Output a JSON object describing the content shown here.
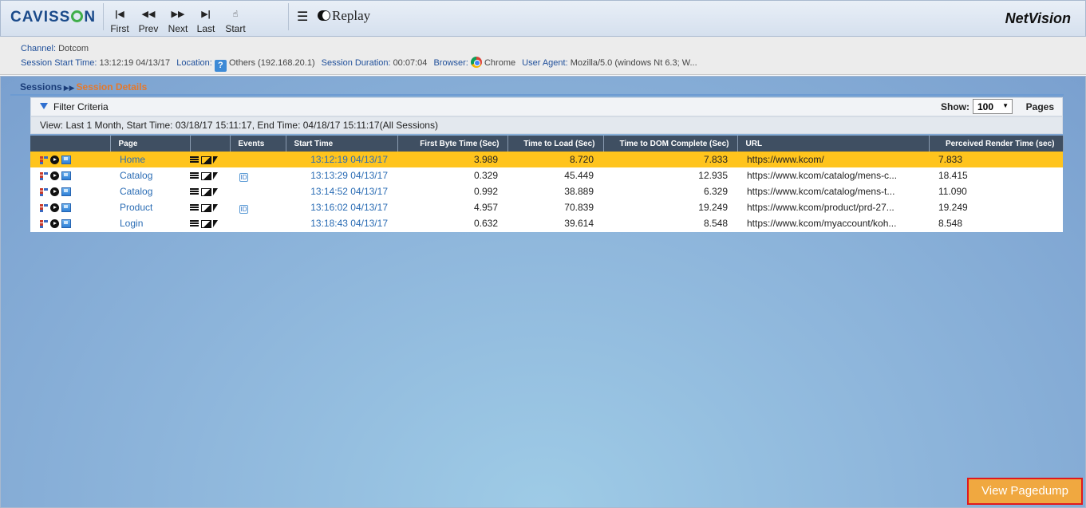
{
  "app": {
    "logo": "CAVISSON",
    "brand": "NetVision"
  },
  "toolbar": {
    "first": "First",
    "prev": "Prev",
    "next": "Next",
    "last": "Last",
    "start": "Start",
    "replay": "Replay"
  },
  "session": {
    "channel_label": "Channel:",
    "channel": "Dotcom",
    "start_label": "Session Start Time:",
    "start": "13:12:19 04/13/17",
    "location_label": "Location:",
    "location": "Others (192.168.20.1)",
    "duration_label": "Session Duration:",
    "duration": "00:07:04",
    "browser_label": "Browser:",
    "browser": "Chrome",
    "agent_label": "User Agent:",
    "agent": "Mozilla/5.0 (windows Nt 6.3; W..."
  },
  "breadcrumb": {
    "sessions": "Sessions",
    "details": "Session Details"
  },
  "filter": {
    "title": "Filter Criteria",
    "show_label": "Show:",
    "show_value": "100",
    "pages_label": "Pages"
  },
  "view_text": "View: Last 1 Month, Start Time: 03/18/17 15:11:17, End Time: 04/18/17 15:11:17(All Sessions)",
  "table": {
    "headers": [
      "Page",
      "Events",
      "Start Time",
      "First Byte Time (Sec)",
      "Time to Load (Sec)",
      "Time to DOM Complete (Sec)",
      "URL",
      "Perceived Render Time (sec)"
    ],
    "rows": [
      {
        "page": "Home",
        "event": "",
        "start": "13:12:19 04/13/17",
        "fbt": "3.989",
        "ttl": "8.720",
        "dom": "7.833",
        "url": "https://www.kcom/",
        "prt": "7.833"
      },
      {
        "page": "Catalog",
        "event": "ID",
        "start": "13:13:29 04/13/17",
        "fbt": "0.329",
        "ttl": "45.449",
        "dom": "12.935",
        "url": "https://www.kcom/catalog/mens-c...",
        "prt": "18.415"
      },
      {
        "page": "Catalog",
        "event": "",
        "start": "13:14:52 04/13/17",
        "fbt": "0.992",
        "ttl": "38.889",
        "dom": "6.329",
        "url": "https://www.kcom/catalog/mens-t...",
        "prt": "11.090"
      },
      {
        "page": "Product",
        "event": "ID",
        "start": "13:16:02 04/13/17",
        "fbt": "4.957",
        "ttl": "70.839",
        "dom": "19.249",
        "url": "https://www.kcom/product/prd-27...",
        "prt": "19.249"
      },
      {
        "page": "Login",
        "event": "",
        "start": "13:18:43 04/13/17",
        "fbt": "0.632",
        "ttl": "39.614",
        "dom": "8.548",
        "url": "https://www.kcom/myaccount/koh...",
        "prt": "8.548"
      }
    ]
  },
  "view_pagedump": "View Pagedump"
}
